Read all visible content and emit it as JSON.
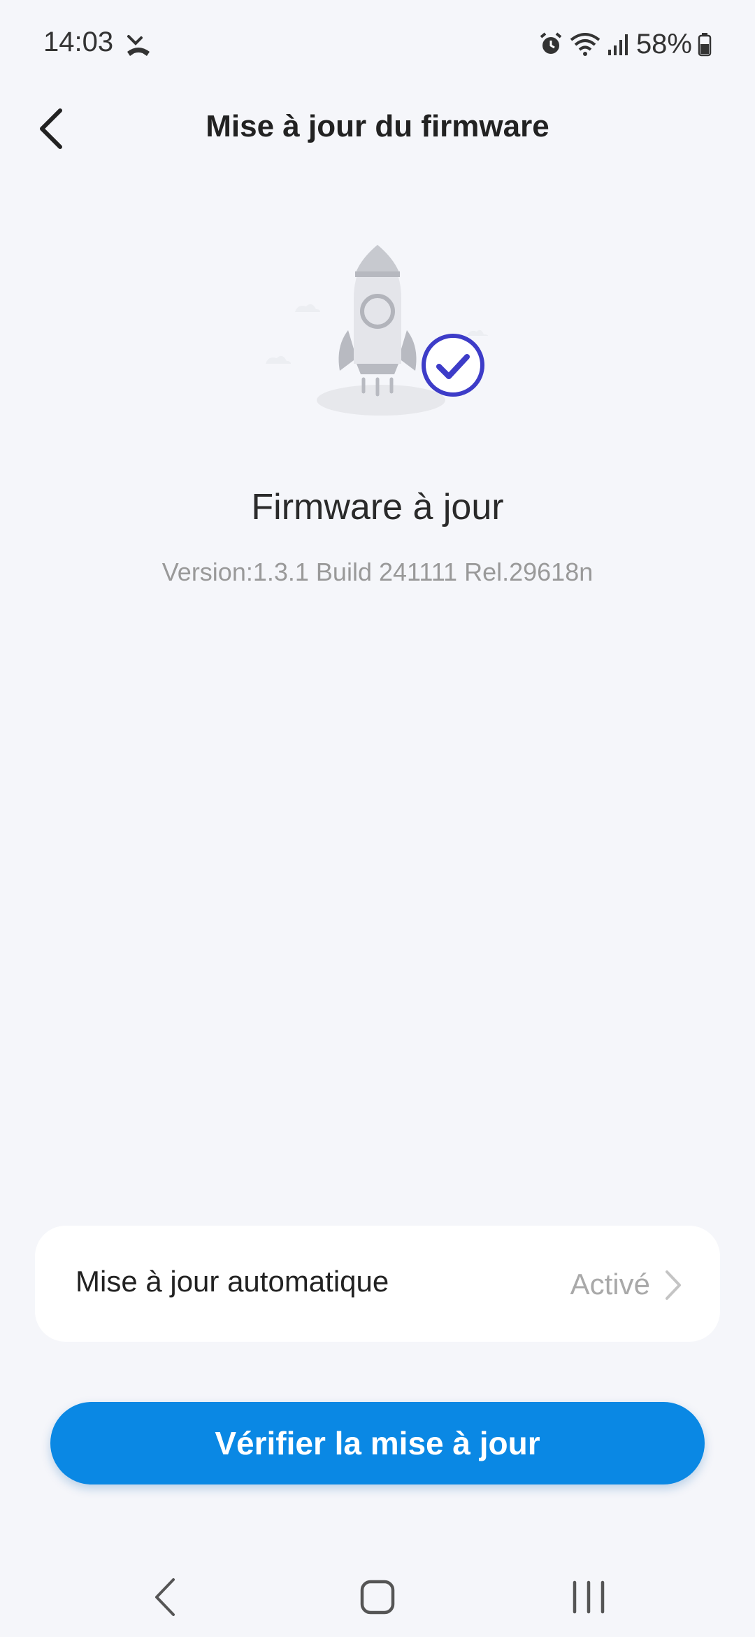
{
  "status_bar": {
    "time": "14:03",
    "battery": "58%",
    "icons": [
      "missed-call-icon",
      "alarm-icon",
      "wifi-icon",
      "signal-icon",
      "battery-icon"
    ]
  },
  "header": {
    "title": "Mise à jour du firmware"
  },
  "main": {
    "status_title": "Firmware à jour",
    "version": "Version:1.3.1 Build 241111 Rel.29618n"
  },
  "auto_update": {
    "label": "Mise à jour automatique",
    "value": "Activé"
  },
  "actions": {
    "check_update_label": "Vérifier la mise à jour"
  },
  "colors": {
    "accent": "#0a88e4",
    "check_badge": "#3d3cc8",
    "background": "#f5f6fa"
  }
}
